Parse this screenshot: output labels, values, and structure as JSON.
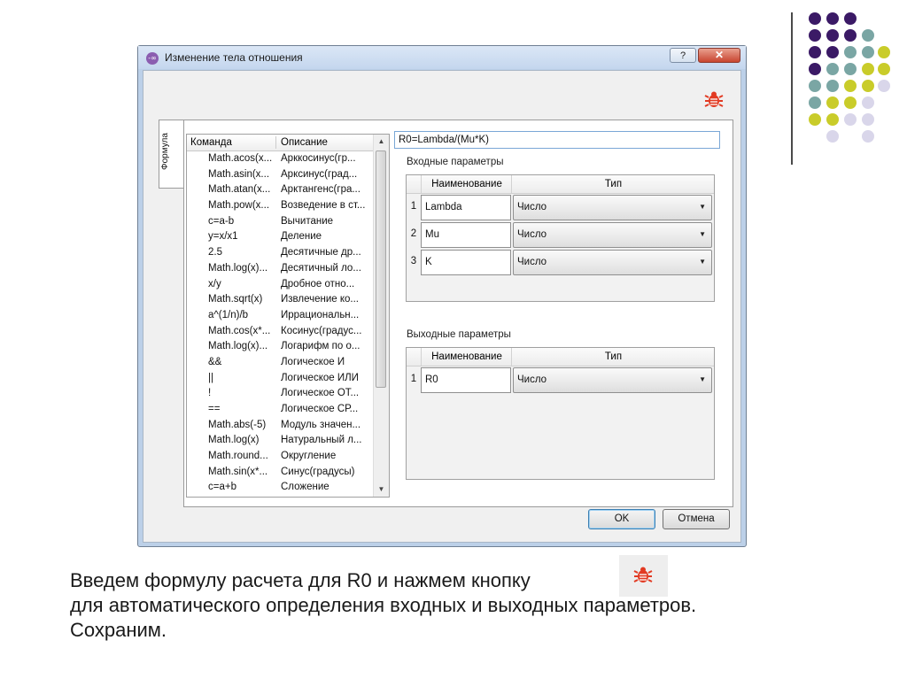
{
  "dialog": {
    "title": "Изменение тела отношения",
    "help_label": "?",
    "close_label": "✕",
    "side_tab_label": "Формула",
    "ok_label": "OK",
    "cancel_label": "Отмена"
  },
  "commands": {
    "headers": [
      "Команда",
      "Описание"
    ],
    "rows": [
      [
        "Math.acos(x...",
        "Арккосинус(гр..."
      ],
      [
        "Math.asin(x...",
        "Арксинус(град..."
      ],
      [
        "Math.atan(x...",
        "Арктангенс(гра..."
      ],
      [
        "Math.pow(x...",
        "Возведение в ст..."
      ],
      [
        "c=a-b",
        "Вычитание"
      ],
      [
        "y=x/x1",
        "Деление"
      ],
      [
        "2.5",
        "Десятичные др..."
      ],
      [
        "Math.log(x)...",
        "Десятичный ло..."
      ],
      [
        "x/y",
        "Дробное отно..."
      ],
      [
        "Math.sqrt(x)",
        "Извлечение ко..."
      ],
      [
        "a^(1/n)/b",
        "Иррациональн..."
      ],
      [
        "Math.cos(x*...",
        "Косинус(градус..."
      ],
      [
        "Math.log(x)...",
        "Логарифм по о..."
      ],
      [
        "&&",
        "Логическое И"
      ],
      [
        "||",
        "Логическое ИЛИ"
      ],
      [
        "!",
        "Логическое ОТ..."
      ],
      [
        "==",
        "Логическое СР..."
      ],
      [
        "Math.abs(-5)",
        "Модуль значен..."
      ],
      [
        "Math.log(x)",
        "Натуральный л..."
      ],
      [
        "Math.round...",
        "Округление"
      ],
      [
        "Math.sin(x*...",
        "Синус(градусы)"
      ],
      [
        "c=a+b",
        "Сложение"
      ]
    ]
  },
  "formula": "R0=Lambda/(Mu*K)",
  "inputs": {
    "label": "Входные параметры",
    "headers": [
      "Наименование",
      "Тип"
    ],
    "rows": [
      {
        "num": "1",
        "name": "Lambda",
        "type": "Число"
      },
      {
        "num": "2",
        "name": "Mu",
        "type": "Число"
      },
      {
        "num": "3",
        "name": "K",
        "type": "Число"
      }
    ]
  },
  "outputs": {
    "label": "Выходные параметры",
    "headers": [
      "Наименование",
      "Тип"
    ],
    "rows": [
      {
        "num": "1",
        "name": "R0",
        "type": "Число"
      }
    ]
  },
  "caption": {
    "line1": "Введем формулу расчета для R0 и нажмем кнопку",
    "line2": "для автоматического определения входных и выходных параметров.",
    "line3": "Сохраним."
  },
  "colors": {
    "dot_purple": "#3b1a66",
    "dot_teal": "#7aa6a4",
    "dot_yellow": "#c9cc2a",
    "dot_lavender": "#d9d6ea",
    "bug_red": "#e23a22"
  },
  "icons": {
    "title_icon": "relation-icon",
    "auto_detect": "bug-icon"
  }
}
